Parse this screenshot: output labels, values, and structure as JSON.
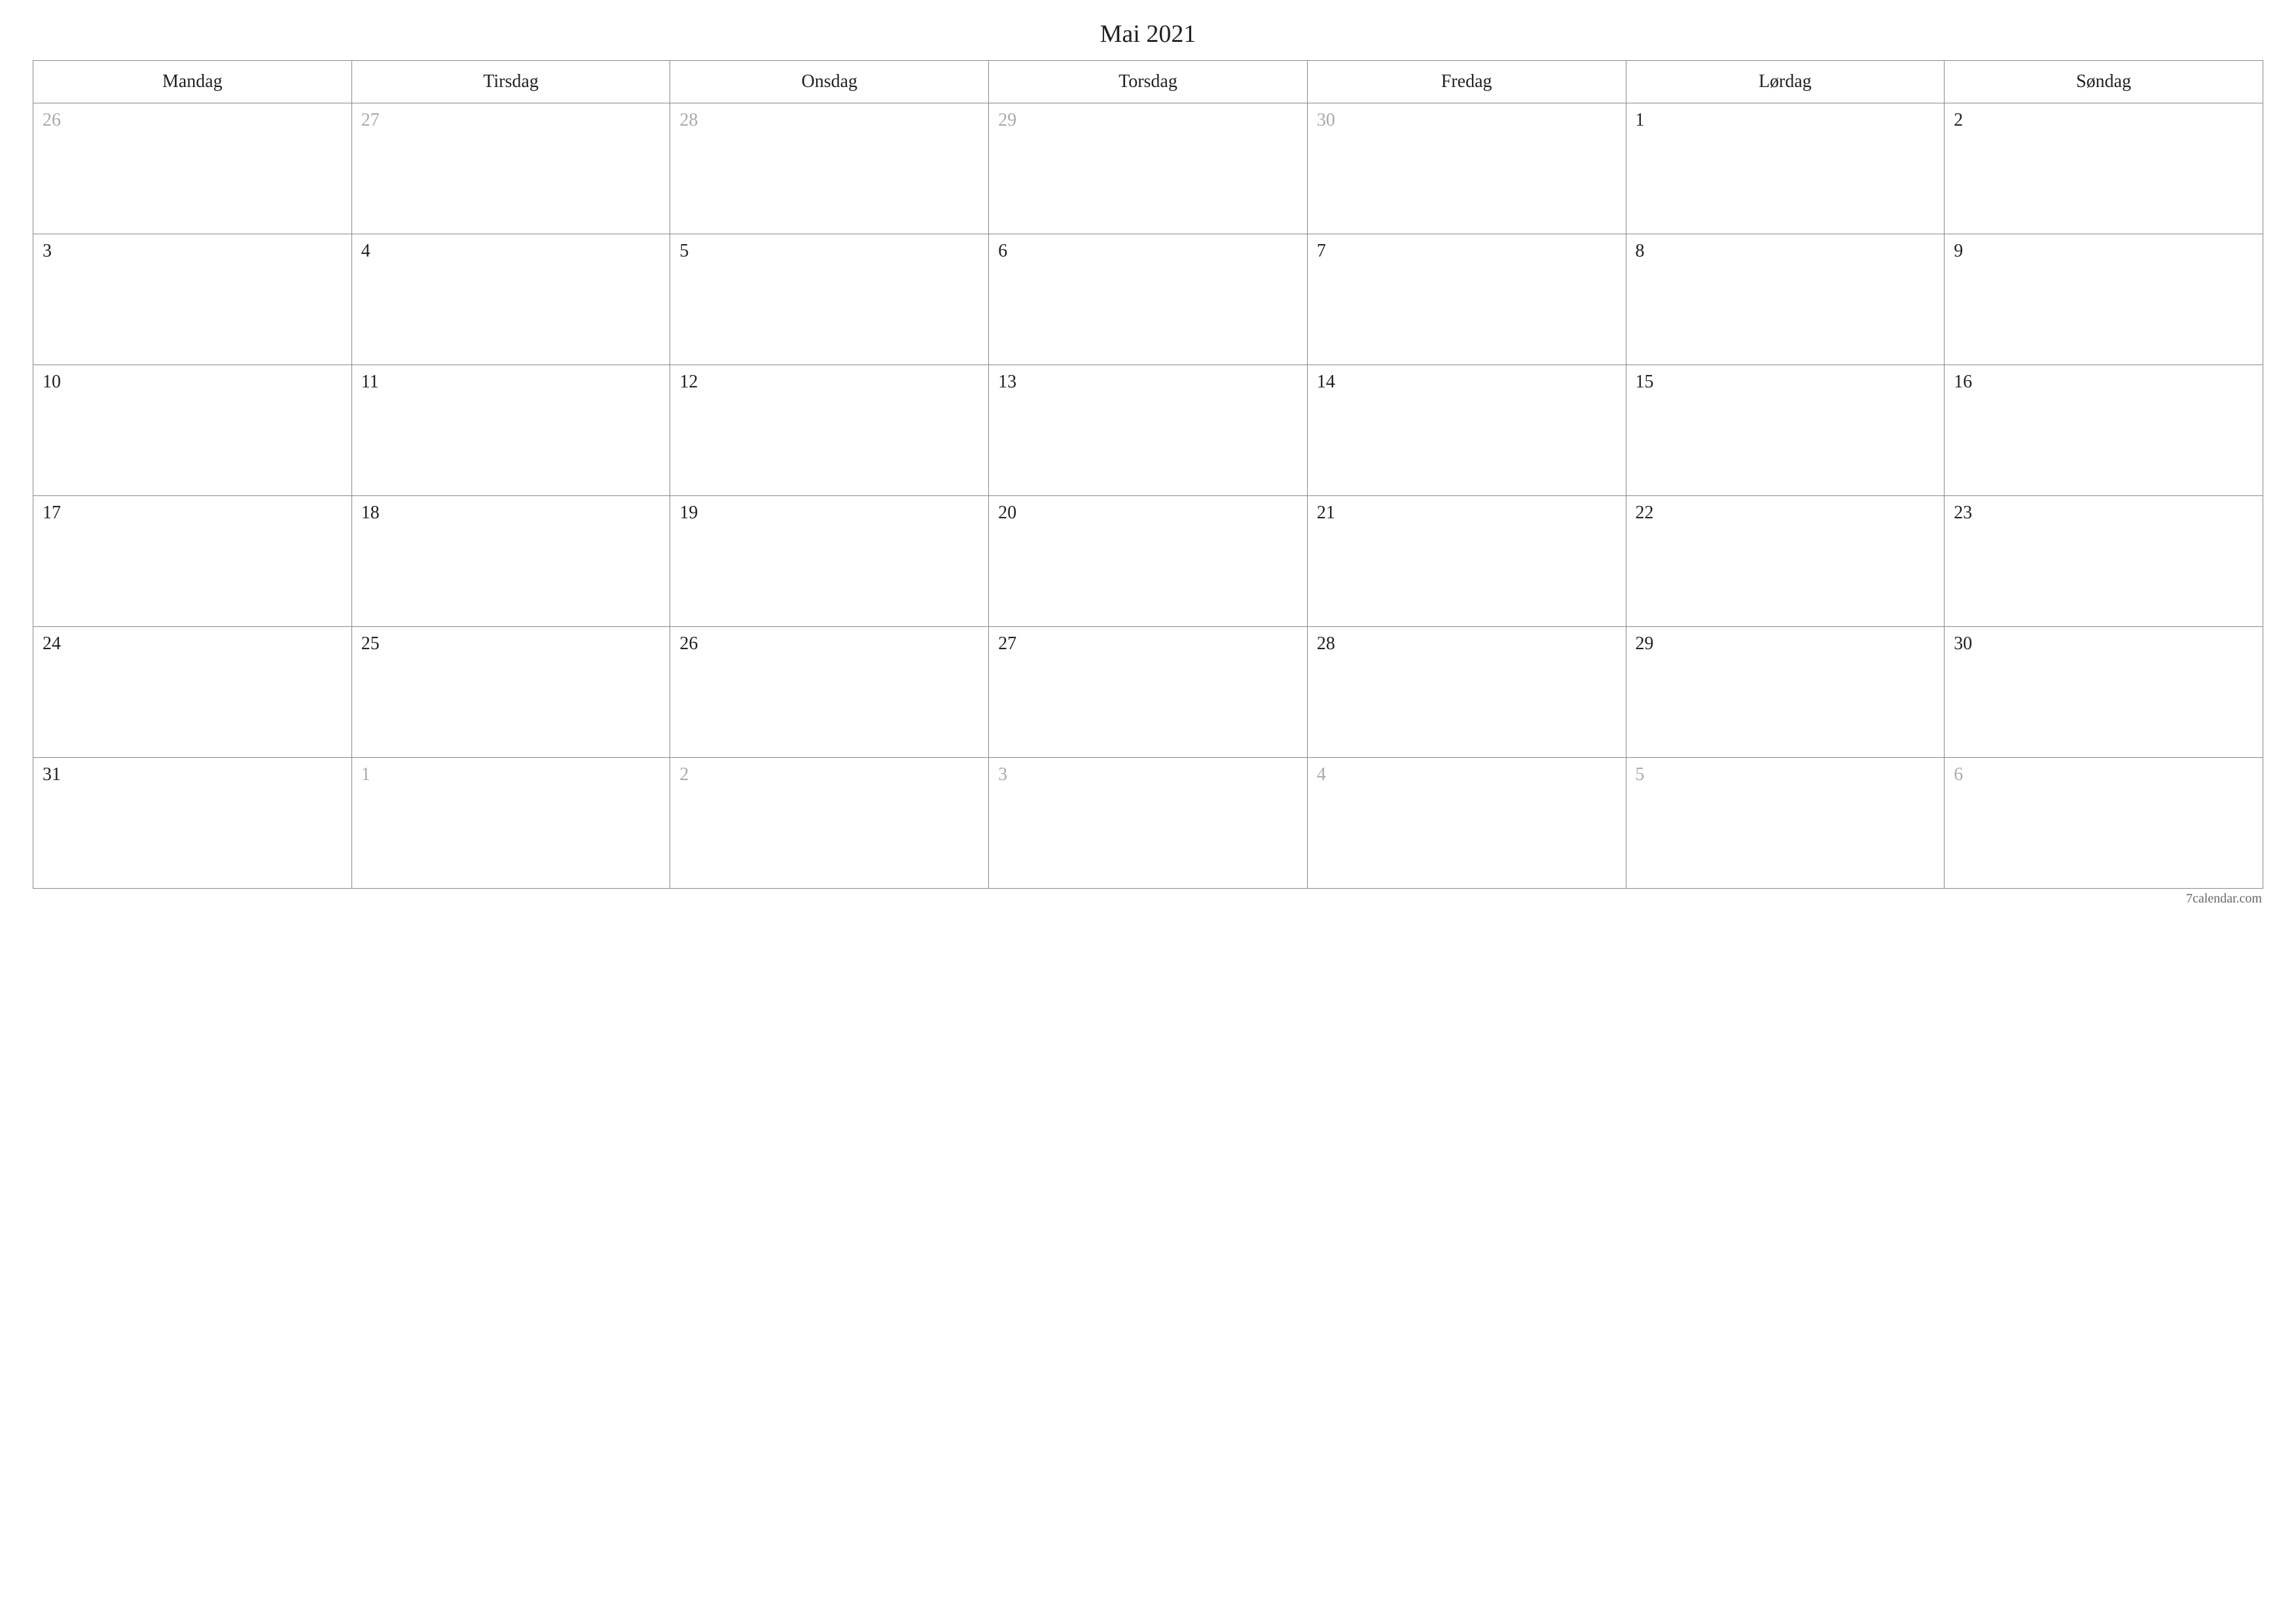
{
  "title": "Mai 2021",
  "weekdays": [
    "Mandag",
    "Tirsdag",
    "Onsdag",
    "Torsdag",
    "Fredag",
    "Lørdag",
    "Søndag"
  ],
  "weeks": [
    [
      {
        "day": "26",
        "other": true
      },
      {
        "day": "27",
        "other": true
      },
      {
        "day": "28",
        "other": true
      },
      {
        "day": "29",
        "other": true
      },
      {
        "day": "30",
        "other": true
      },
      {
        "day": "1",
        "other": false
      },
      {
        "day": "2",
        "other": false
      }
    ],
    [
      {
        "day": "3",
        "other": false
      },
      {
        "day": "4",
        "other": false
      },
      {
        "day": "5",
        "other": false
      },
      {
        "day": "6",
        "other": false
      },
      {
        "day": "7",
        "other": false
      },
      {
        "day": "8",
        "other": false
      },
      {
        "day": "9",
        "other": false
      }
    ],
    [
      {
        "day": "10",
        "other": false
      },
      {
        "day": "11",
        "other": false
      },
      {
        "day": "12",
        "other": false
      },
      {
        "day": "13",
        "other": false
      },
      {
        "day": "14",
        "other": false
      },
      {
        "day": "15",
        "other": false
      },
      {
        "day": "16",
        "other": false
      }
    ],
    [
      {
        "day": "17",
        "other": false
      },
      {
        "day": "18",
        "other": false
      },
      {
        "day": "19",
        "other": false
      },
      {
        "day": "20",
        "other": false
      },
      {
        "day": "21",
        "other": false
      },
      {
        "day": "22",
        "other": false
      },
      {
        "day": "23",
        "other": false
      }
    ],
    [
      {
        "day": "24",
        "other": false
      },
      {
        "day": "25",
        "other": false
      },
      {
        "day": "26",
        "other": false
      },
      {
        "day": "27",
        "other": false
      },
      {
        "day": "28",
        "other": false
      },
      {
        "day": "29",
        "other": false
      },
      {
        "day": "30",
        "other": false
      }
    ],
    [
      {
        "day": "31",
        "other": false
      },
      {
        "day": "1",
        "other": true
      },
      {
        "day": "2",
        "other": true
      },
      {
        "day": "3",
        "other": true
      },
      {
        "day": "4",
        "other": true
      },
      {
        "day": "5",
        "other": true
      },
      {
        "day": "6",
        "other": true
      }
    ]
  ],
  "footer": "7calendar.com"
}
